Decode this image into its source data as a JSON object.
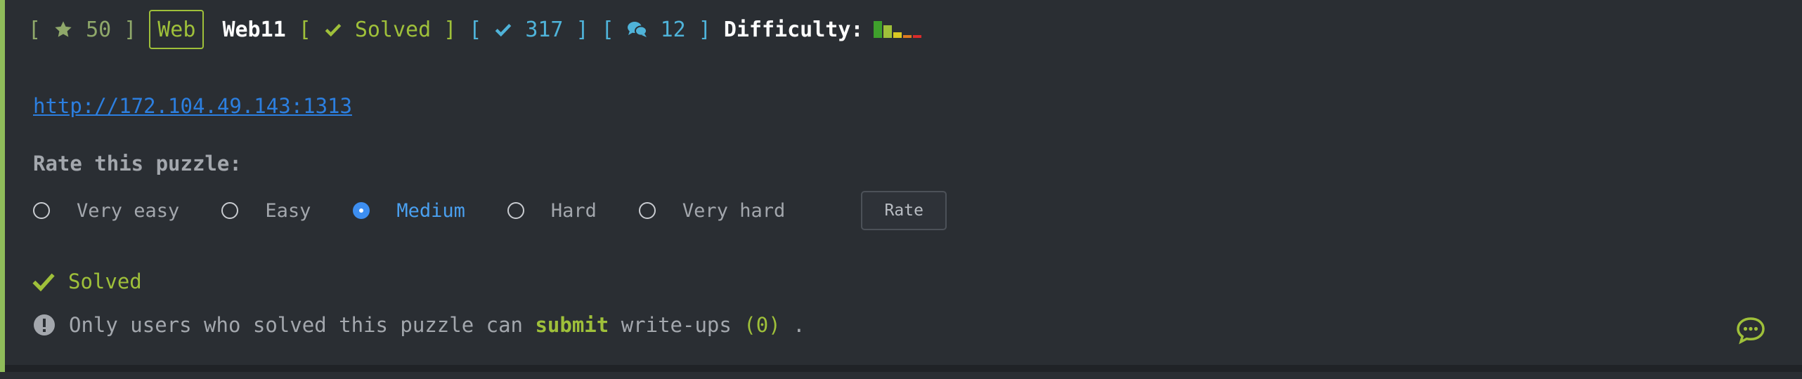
{
  "header": {
    "open_bracket": "[",
    "close_bracket": "]",
    "points": "50",
    "category": "Web",
    "title": "Web11",
    "status": "Solved",
    "solves": "317",
    "comments": "12",
    "difficulty_label": "Difficulty:",
    "difficulty_colors": [
      "#3fa02c",
      "#9fc03a",
      "#d9c824",
      "#e07a1f",
      "#d92b2b"
    ]
  },
  "challenge": {
    "link": "http://172.104.49.143:1313"
  },
  "rating": {
    "title": "Rate this puzzle:",
    "options": [
      "Very easy",
      "Easy",
      "Medium",
      "Hard",
      "Very hard"
    ],
    "selected": "Medium",
    "button_label": "Rate"
  },
  "status": {
    "solved_label": "Solved"
  },
  "notice": {
    "text_before": "Only users who solved this puzzle can ",
    "submit_label": "submit",
    "text_middle": " write-ups ",
    "count": "(0)",
    "text_after": " ."
  },
  "icons": {
    "points": "star-icon",
    "status": "check-icon",
    "solves": "check-icon",
    "comments": "comments-icon",
    "notice": "exclamation-circle-icon",
    "chat": "chat-bubble-icon"
  }
}
